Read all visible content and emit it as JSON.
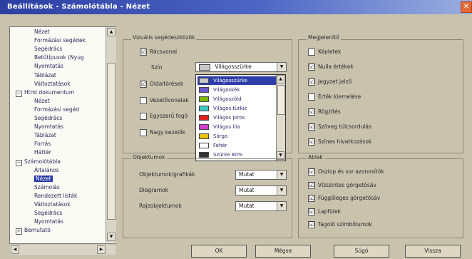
{
  "window": {
    "title": "Beállítások - Számolótábla - Nézet",
    "close_symbol": "✕"
  },
  "tree": {
    "items": [
      {
        "label": "Nézet",
        "level": 2
      },
      {
        "label": "Formázási segédek",
        "level": 2
      },
      {
        "label": "Segédrács",
        "level": 2
      },
      {
        "label": "Betűtípusok (Nyug",
        "level": 2
      },
      {
        "label": "Nyomtatás",
        "level": 2
      },
      {
        "label": "Táblázat",
        "level": 2
      },
      {
        "label": "Változtatások",
        "level": 2
      },
      {
        "label": "Html dokumentum",
        "level": 1,
        "expander": "⊟"
      },
      {
        "label": "Nézet",
        "level": 2
      },
      {
        "label": "Formázási segéd",
        "level": 2
      },
      {
        "label": "Segédrács",
        "level": 2
      },
      {
        "label": "Nyomtatás",
        "level": 2
      },
      {
        "label": "Táblázat",
        "level": 2
      },
      {
        "label": "Forrás",
        "level": 2
      },
      {
        "label": "Háttér",
        "level": 2
      },
      {
        "label": "Számolótábla",
        "level": 1,
        "expander": "⊟"
      },
      {
        "label": "Általános",
        "level": 2
      },
      {
        "label": "Nézet",
        "level": 2,
        "selected": true
      },
      {
        "label": "Számolás",
        "level": 2
      },
      {
        "label": "Rendezett listák",
        "level": 2
      },
      {
        "label": "Változtatások",
        "level": 2
      },
      {
        "label": "Segédrács",
        "level": 2
      },
      {
        "label": "Nyomtatás",
        "level": 2
      },
      {
        "label": "Bemutató",
        "level": 1,
        "expander": "⊞"
      }
    ]
  },
  "visual_aids": {
    "title": "Vizuális segédeszközök",
    "racsvonal": {
      "label": "Rácsvonal",
      "checked": true
    },
    "szin_label": "Szín",
    "color_select": "Világosszürke",
    "oldaltores": {
      "label": "Oldaltörések",
      "checked": true
    },
    "vezetovonalak": {
      "label": "Vezetővonalak",
      "checked": false
    },
    "egyszeru_leped": {
      "label": "Egyszerű fogó",
      "checked": false
    },
    "nagy_kezelok": {
      "label": "Nagy kezelők",
      "checked": false
    }
  },
  "color_list": [
    {
      "name": "Világosszürke",
      "color": "#c8c8c8",
      "selected": true
    },
    {
      "name": "Világoskék",
      "color": "#6a5acd"
    },
    {
      "name": "Világoszöld",
      "color": "#7ab800"
    },
    {
      "name": "Világos türkiz",
      "color": "#40c8c8"
    },
    {
      "name": "Világos piros",
      "color": "#e02020"
    },
    {
      "name": "Világos lila",
      "color": "#d040d0"
    },
    {
      "name": "Sárga",
      "color": "#e8c000"
    },
    {
      "name": "Fehér",
      "color": "#ffffff"
    },
    {
      "name": "Szürke 80%",
      "color": "#333333"
    }
  ],
  "objects": {
    "title": "Objektumok",
    "rows": [
      {
        "label": "Objektumok/grafikák",
        "value": "Mutat"
      },
      {
        "label": "Diagramok",
        "value": "Mutat"
      },
      {
        "label": "Rajzobjektumok",
        "value": "Mutat"
      }
    ]
  },
  "display": {
    "title": "Megjelenítő",
    "items": [
      {
        "label": "Képletek",
        "checked": false
      },
      {
        "label": "Nulla értékek",
        "checked": true
      },
      {
        "label": "Jegyzet jelző",
        "checked": true
      },
      {
        "label": "Érték kiemelése",
        "checked": false
      },
      {
        "label": "Rögzítés",
        "checked": true
      },
      {
        "label": "Szöveg túlcsordulás",
        "checked": true
      },
      {
        "label": "Színes hivatkozások",
        "checked": true
      }
    ]
  },
  "window_group": {
    "title": "Ablak",
    "items": [
      {
        "label": "Oszlop és sor azonosítók",
        "checked": true
      },
      {
        "label": "Vízszintes görgetősáv",
        "checked": true
      },
      {
        "label": "Függőleges görgetősáv",
        "checked": true
      },
      {
        "label": "Lapfülek",
        "checked": true
      },
      {
        "label": "Tagoló szimbólumok",
        "checked": true
      }
    ]
  },
  "buttons": {
    "ok": "OK",
    "cancel": "Mégse",
    "help": "Súgó",
    "back": "Vissza"
  },
  "check_glyph": "☑"
}
